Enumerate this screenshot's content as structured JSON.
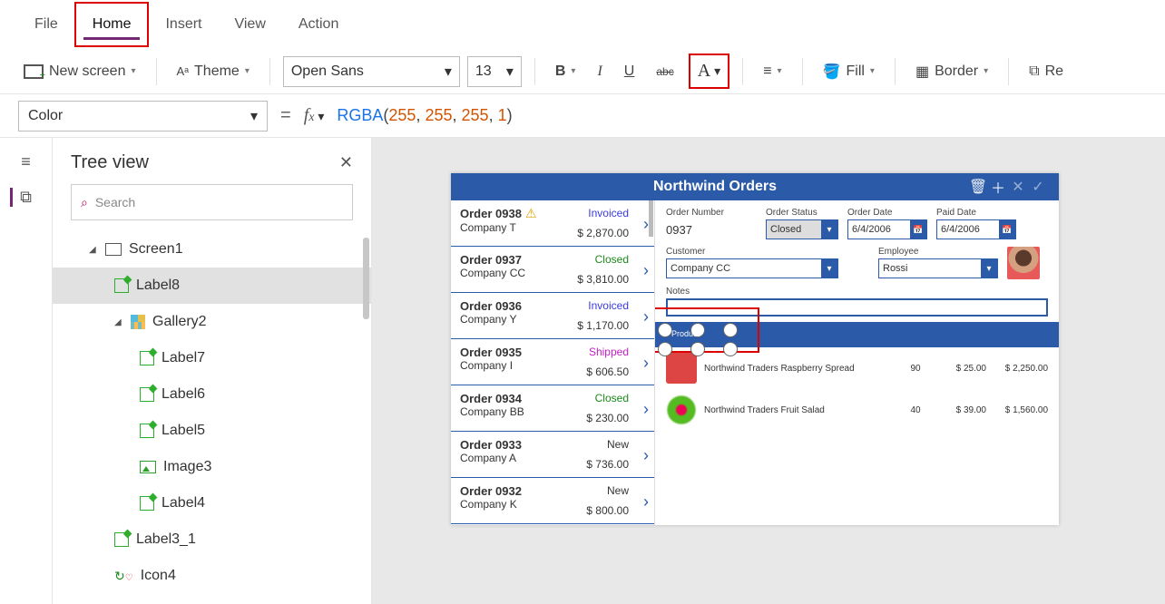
{
  "menu": {
    "file": "File",
    "home": "Home",
    "insert": "Insert",
    "view": "View",
    "action": "Action"
  },
  "toolbar": {
    "new_screen": "New screen",
    "theme": "Theme",
    "font": "Open Sans",
    "font_size": "13",
    "fill": "Fill",
    "border": "Border",
    "reorder": "Re"
  },
  "fx": {
    "property": "Color",
    "fn": "RGBA",
    "args": [
      "255",
      "255",
      "255",
      "1"
    ]
  },
  "tree": {
    "title": "Tree view",
    "search_ph": "Search",
    "items": [
      {
        "label": "Screen1"
      },
      {
        "label": "Label8"
      },
      {
        "label": "Gallery2"
      },
      {
        "label": "Label7"
      },
      {
        "label": "Label6"
      },
      {
        "label": "Label5"
      },
      {
        "label": "Image3"
      },
      {
        "label": "Label4"
      },
      {
        "label": "Label3_1"
      },
      {
        "label": "Icon4"
      }
    ]
  },
  "app": {
    "title": "Northwind Orders",
    "orders": [
      {
        "id": "Order 0938",
        "company": "Company T",
        "status": "Invoiced",
        "status_class": "s-invoiced",
        "price": "$ 2,870.00",
        "warn": true
      },
      {
        "id": "Order 0937",
        "company": "Company CC",
        "status": "Closed",
        "status_class": "s-closed",
        "price": "$ 3,810.00"
      },
      {
        "id": "Order 0936",
        "company": "Company Y",
        "status": "Invoiced",
        "status_class": "s-invoiced",
        "price": "$ 1,170.00"
      },
      {
        "id": "Order 0935",
        "company": "Company I",
        "status": "Shipped",
        "status_class": "s-shipped",
        "price": "$ 606.50"
      },
      {
        "id": "Order 0934",
        "company": "Company BB",
        "status": "Closed",
        "status_class": "s-closed",
        "price": "$ 230.00"
      },
      {
        "id": "Order 0933",
        "company": "Company A",
        "status": "New",
        "status_class": "s-new",
        "price": "$ 736.00"
      },
      {
        "id": "Order 0932",
        "company": "Company K",
        "status": "New",
        "status_class": "s-new",
        "price": "$ 800.00"
      }
    ],
    "detail": {
      "labels": {
        "order_number": "Order Number",
        "order_status": "Order Status",
        "order_date": "Order Date",
        "paid_date": "Paid Date",
        "customer": "Customer",
        "employee": "Employee",
        "notes": "Notes",
        "product": "Product"
      },
      "order_number": "0937",
      "order_status": "Closed",
      "order_date": "6/4/2006",
      "paid_date": "6/4/2006",
      "customer": "Company CC",
      "employee": "Rossi",
      "line_items": [
        {
          "name": "Northwind Traders Raspberry Spread",
          "qty": "90",
          "unit": "$ 25.00",
          "total": "$ 2,250.00"
        },
        {
          "name": "Northwind Traders Fruit Salad",
          "qty": "40",
          "unit": "$ 39.00",
          "total": "$ 1,560.00"
        }
      ]
    }
  }
}
